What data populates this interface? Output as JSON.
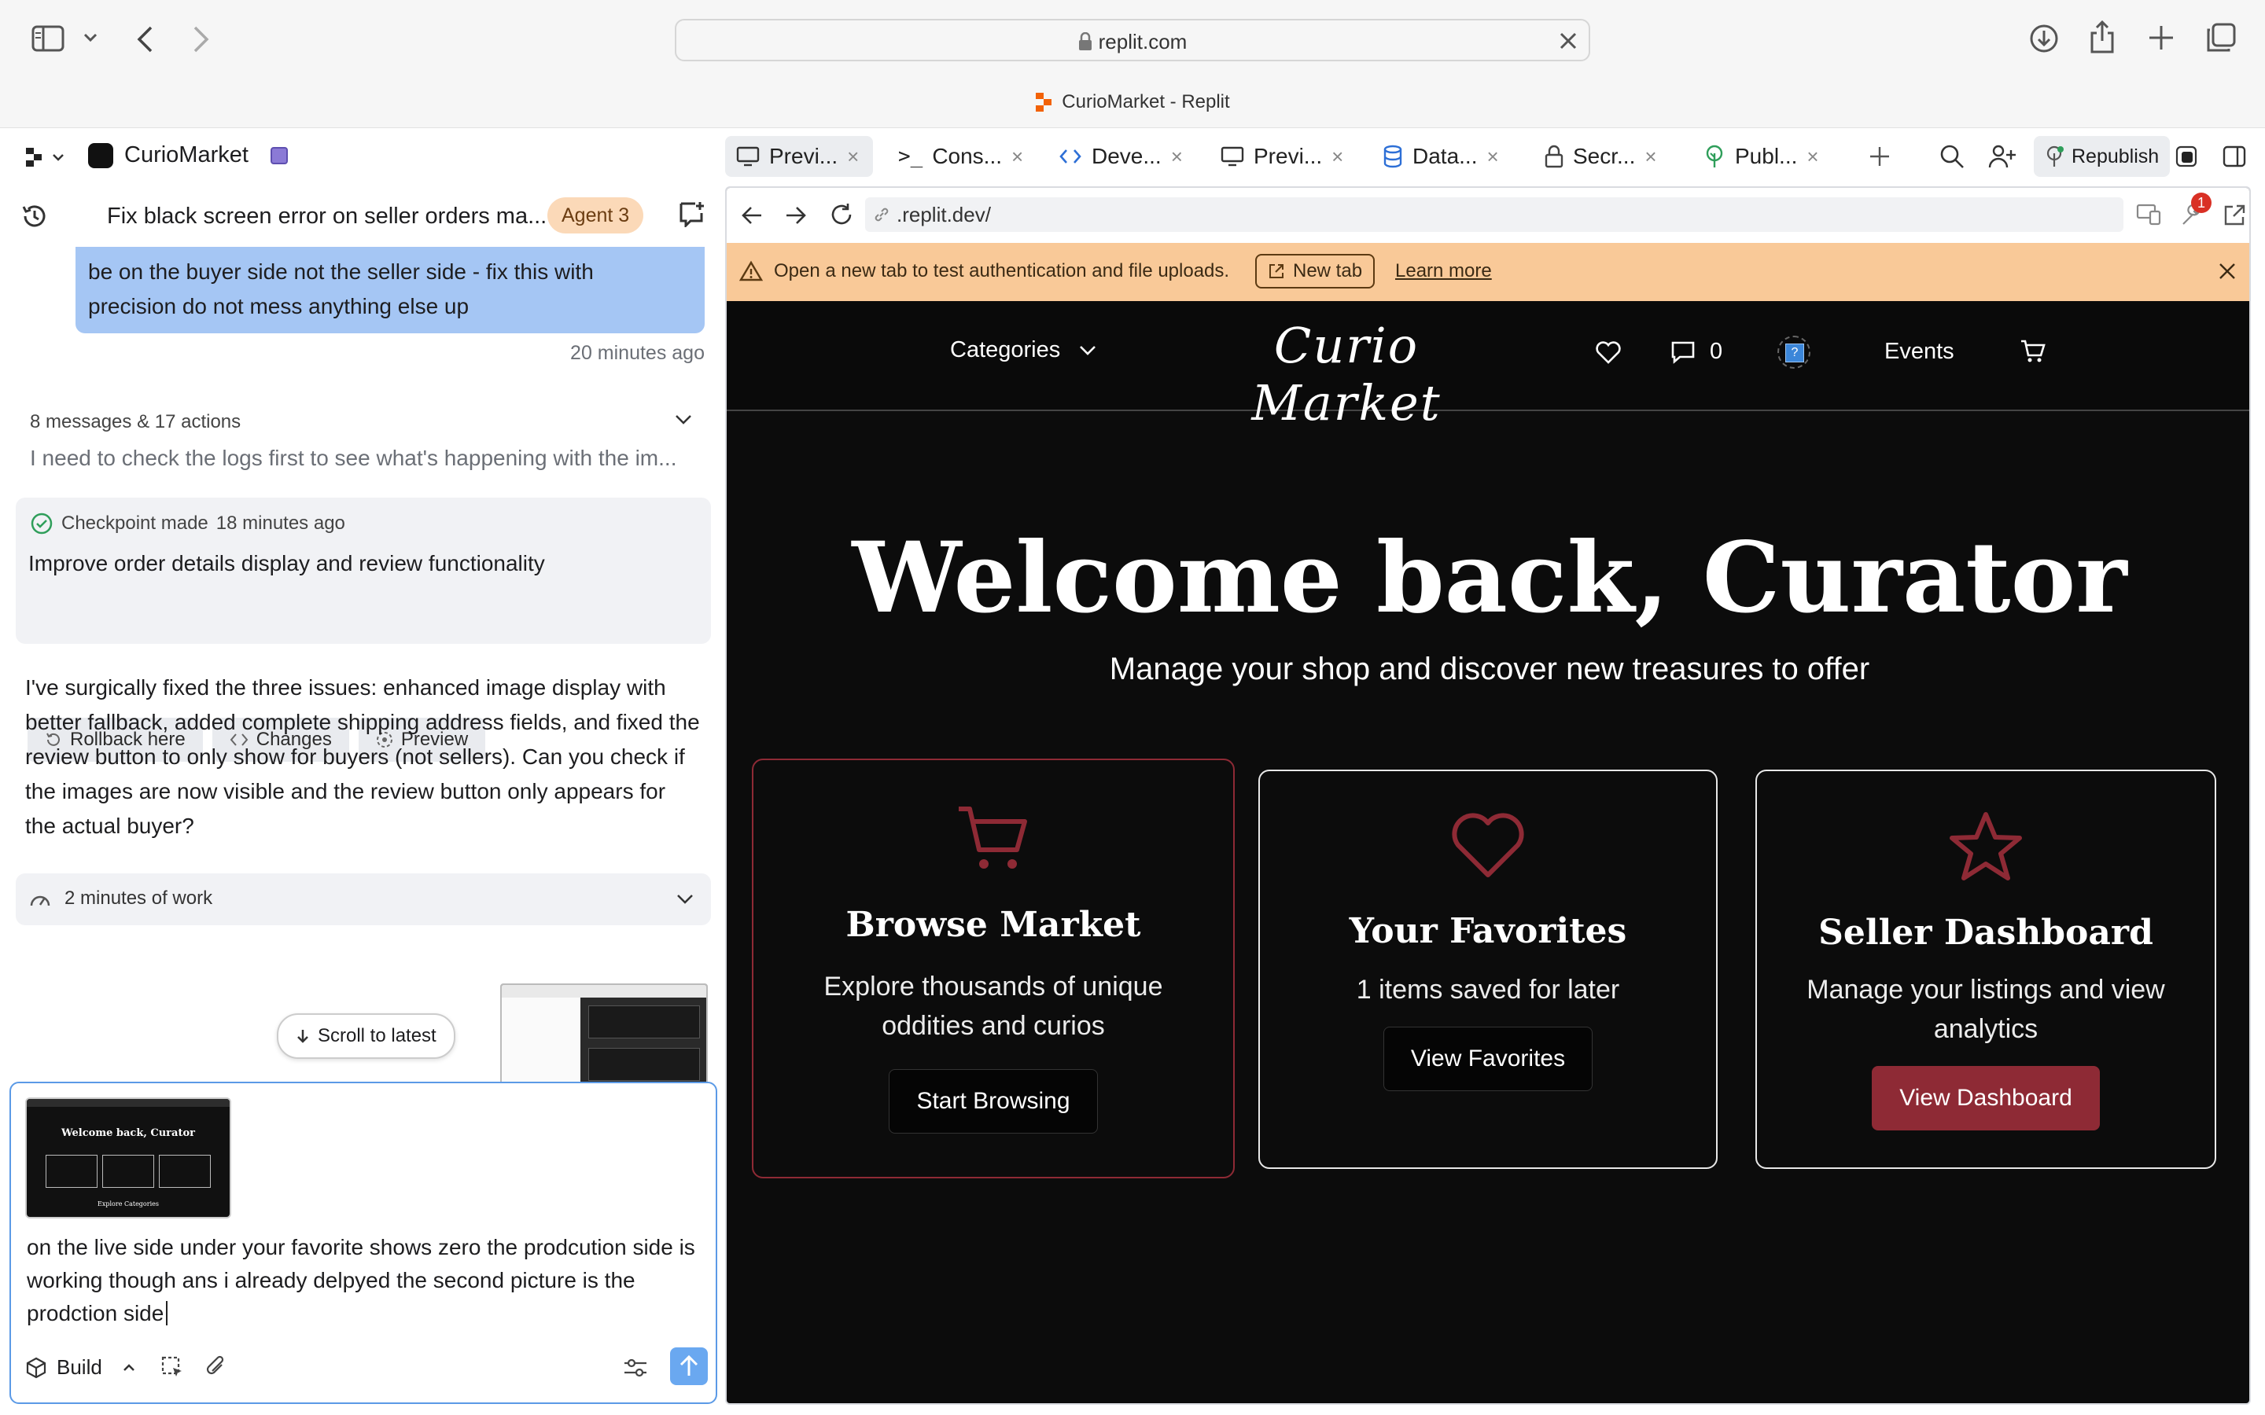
{
  "browser": {
    "url": "replit.com",
    "tab_title": "CurioMarket - Replit"
  },
  "replit": {
    "project_name": "CurioMarket",
    "agent": {
      "task_title": "Fix black screen error on seller orders ma...",
      "agent_badge": "Agent 3",
      "user_message_line1": "be on the buyer side not the seller side - fix this with",
      "user_message_line2": "precision do not mess anything else up",
      "message_time": "20 minutes ago",
      "summary_count": "8 messages & 17 actions",
      "summary_preview": "I need to check the logs first to see what's happening with the im...",
      "checkpoint_label": "Checkpoint made",
      "checkpoint_time": "18 minutes ago",
      "checkpoint_title": "Improve order details display and review functionality",
      "rollback_label": "Rollback here",
      "changes_label": "Changes",
      "preview_label": "Preview",
      "response_text": "I've surgically fixed the three issues: enhanced image display with better fallback, added complete shipping address fields, and fixed the review button to only show for buyers (not sellers). Can you check if the images are now visible and the review button only appears for the actual buyer?",
      "work_label": "2 minutes of work",
      "scroll_latest": "Scroll to latest",
      "composer_text": "on the live side under your favorite shows zero the prodcution side is working though ans i already delpyed the second picture is the prodction side",
      "mode_label": "Build"
    },
    "tabs": [
      {
        "label": "Previ..."
      },
      {
        "label": "Cons..."
      },
      {
        "label": "Deve..."
      },
      {
        "label": "Previ..."
      },
      {
        "label": "Data..."
      },
      {
        "label": "Secr..."
      },
      {
        "label": "Publ..."
      }
    ],
    "republish_label": "Republish",
    "notification_count": "1"
  },
  "webview": {
    "address": ".replit.dev/",
    "notice_text": "Open a new tab to test authentication and file uploads.",
    "new_tab_label": "New tab",
    "learn_more_label": "Learn more"
  },
  "site": {
    "nav_categories": "Categories",
    "logo": "Curio Market",
    "message_count": "0",
    "events_label": "Events",
    "hero_title": "Welcome back, Curator",
    "hero_subtitle": "Manage your shop and discover new treasures to offer",
    "cards": [
      {
        "title": "Browse Market",
        "desc_1": "Explore thousands of unique",
        "desc_2": "oddities and curios",
        "button": "Start Browsing",
        "icon": "cart-icon"
      },
      {
        "title": "Your Favorites",
        "desc_1": "1 items saved for later",
        "desc_2": "",
        "button": "View Favorites",
        "icon": "heart-icon"
      },
      {
        "title": "Seller Dashboard",
        "desc_1": "Manage your listings and view",
        "desc_2": "analytics",
        "button": "View Dashboard",
        "icon": "star-icon"
      }
    ],
    "thumb_title": "Welcome back, Curator",
    "thumb_footer": "Explore Categories"
  },
  "colors": {
    "accent_red": "#8e2a35",
    "notice_bg": "#f9c998",
    "selected_message": "#a5c6f4",
    "composer_border": "#5b9ae6",
    "send_button": "#6aa8f0"
  }
}
